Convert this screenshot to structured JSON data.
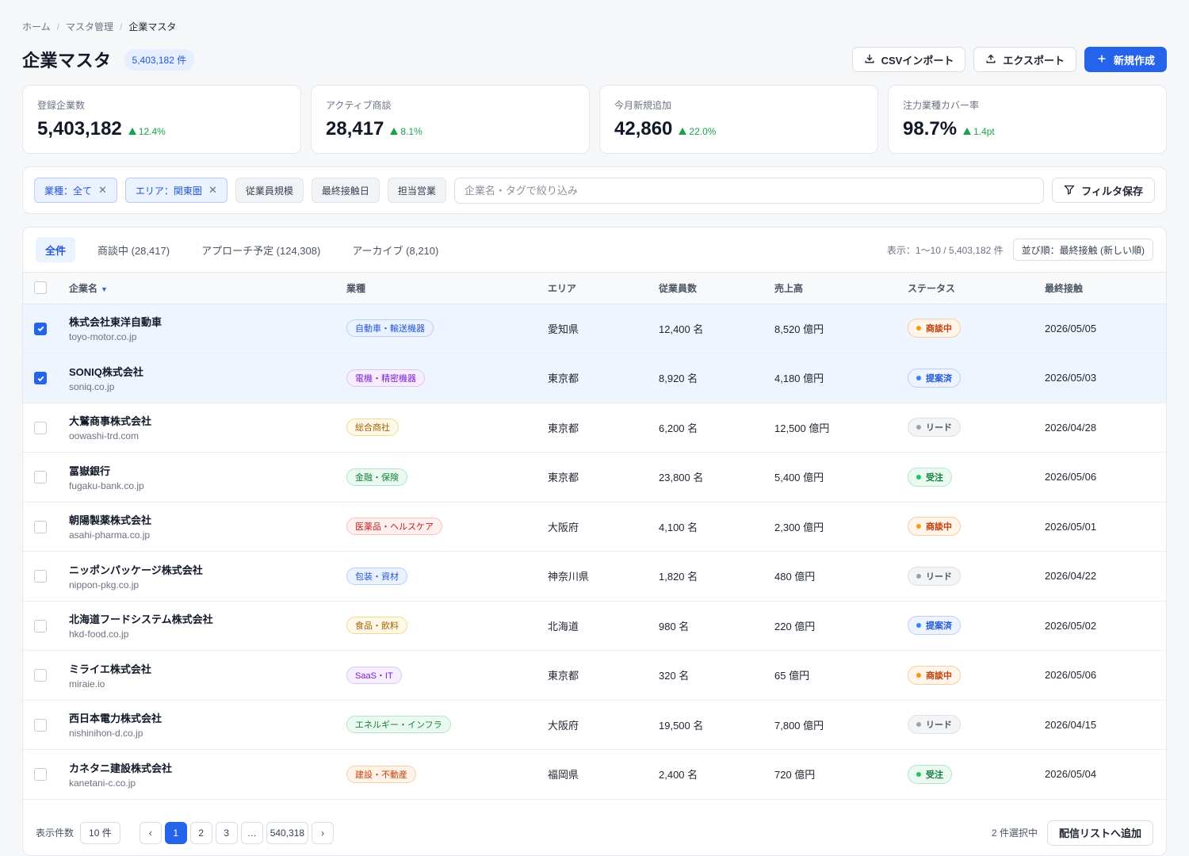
{
  "breadcrumb": [
    "ホーム",
    "マスタ管理",
    "企業マスタ"
  ],
  "header": {
    "title": "企業マスタ",
    "count_badge": "5,403,182 件",
    "import_label": "CSVインポート",
    "export_label": "エクスポート",
    "create_label": "新規作成"
  },
  "stats": [
    {
      "label": "登録企業数",
      "value": "5,403,182",
      "delta": "12.4%"
    },
    {
      "label": "アクティブ商談",
      "value": "28,417",
      "delta": "8.1%"
    },
    {
      "label": "今月新規追加",
      "value": "42,860",
      "delta": "22.0%"
    },
    {
      "label": "注力業種カバー率",
      "value": "98.7%",
      "delta": "1.4pt"
    }
  ],
  "filters": {
    "active_chips": [
      "業種：全て",
      "エリア：関東圏"
    ],
    "plain_chips": [
      "従業員規模",
      "最終接触日",
      "担当営業"
    ],
    "search_placeholder": "企業名・タグで絞り込み",
    "save_label": "フィルタ保存"
  },
  "tabs": [
    {
      "label": "全件",
      "active": true
    },
    {
      "label": "商談中 (28,417)",
      "active": false
    },
    {
      "label": "アプローチ予定 (124,308)",
      "active": false
    },
    {
      "label": "アーカイブ (8,210)",
      "active": false
    }
  ],
  "table_meta": {
    "showing": "表示：1〜10 / 5,403,182 件",
    "sort": "並び順：最終接触 (新しい順)"
  },
  "columns": [
    "企業名",
    "業種",
    "エリア",
    "従業員数",
    "売上高",
    "ステータス",
    "最終接触"
  ],
  "rows": [
    {
      "checked": true,
      "name": "株式会社東洋自動車",
      "domain": "toyo-motor.co.jp",
      "industry": "自動車・輸送機器",
      "tag_color": "blue",
      "area": "愛知県",
      "employees": "12,400 名",
      "revenue": "8,520 億円",
      "status": "商談中",
      "status_color": "orange",
      "last": "2026/05/05"
    },
    {
      "checked": true,
      "name": "SONIQ株式会社",
      "domain": "soniq.co.jp",
      "industry": "電機・精密機器",
      "tag_color": "purple",
      "area": "東京都",
      "employees": "8,920 名",
      "revenue": "4,180 億円",
      "status": "提案済",
      "status_color": "blue",
      "last": "2026/05/03"
    },
    {
      "checked": false,
      "name": "大鷲商事株式会社",
      "domain": "oowashi-trd.com",
      "industry": "総合商社",
      "tag_color": "amber",
      "area": "東京都",
      "employees": "6,200 名",
      "revenue": "12,500 億円",
      "status": "リード",
      "status_color": "gray",
      "last": "2026/04/28"
    },
    {
      "checked": false,
      "name": "冨嶽銀行",
      "domain": "fugaku-bank.co.jp",
      "industry": "金融・保険",
      "tag_color": "green",
      "area": "東京都",
      "employees": "23,800 名",
      "revenue": "5,400 億円",
      "status": "受注",
      "status_color": "green",
      "last": "2026/05/06"
    },
    {
      "checked": false,
      "name": "朝陽製薬株式会社",
      "domain": "asahi-pharma.co.jp",
      "industry": "医薬品・ヘルスケア",
      "tag_color": "red",
      "area": "大阪府",
      "employees": "4,100 名",
      "revenue": "2,300 億円",
      "status": "商談中",
      "status_color": "orange",
      "last": "2026/05/01"
    },
    {
      "checked": false,
      "name": "ニッポンパッケージ株式会社",
      "domain": "nippon-pkg.co.jp",
      "industry": "包装・資材",
      "tag_color": "blue",
      "area": "神奈川県",
      "employees": "1,820 名",
      "revenue": "480 億円",
      "status": "リード",
      "status_color": "gray",
      "last": "2026/04/22"
    },
    {
      "checked": false,
      "name": "北海道フードシステム株式会社",
      "domain": "hkd-food.co.jp",
      "industry": "食品・飲料",
      "tag_color": "amber",
      "area": "北海道",
      "employees": "980 名",
      "revenue": "220 億円",
      "status": "提案済",
      "status_color": "blue",
      "last": "2026/05/02"
    },
    {
      "checked": false,
      "name": "ミライエ株式会社",
      "domain": "miraie.io",
      "industry": "SaaS・IT",
      "tag_color": "purple",
      "area": "東京都",
      "employees": "320 名",
      "revenue": "65 億円",
      "status": "商談中",
      "status_color": "orange",
      "last": "2026/05/06"
    },
    {
      "checked": false,
      "name": "西日本電力株式会社",
      "domain": "nishinihon-d.co.jp",
      "industry": "エネルギー・インフラ",
      "tag_color": "green",
      "area": "大阪府",
      "employees": "19,500 名",
      "revenue": "7,800 億円",
      "status": "リード",
      "status_color": "gray",
      "last": "2026/04/15"
    },
    {
      "checked": false,
      "name": "カネタニ建設株式会社",
      "domain": "kanetani-c.co.jp",
      "industry": "建設・不動産",
      "tag_color": "orange",
      "area": "福岡県",
      "employees": "2,400 名",
      "revenue": "720 億円",
      "status": "受注",
      "status_color": "green",
      "last": "2026/05/04"
    }
  ],
  "footer": {
    "per_page_label": "表示件数",
    "per_page_value": "10 件",
    "pages": [
      "‹",
      "1",
      "2",
      "3",
      "…",
      "540,318",
      "›"
    ],
    "active_page": "1",
    "selected_count": "2 件選択中",
    "add_list_label": "配信リストへ追加"
  },
  "colors": {
    "accent": "#2563eb",
    "positive": "#16a34a"
  }
}
